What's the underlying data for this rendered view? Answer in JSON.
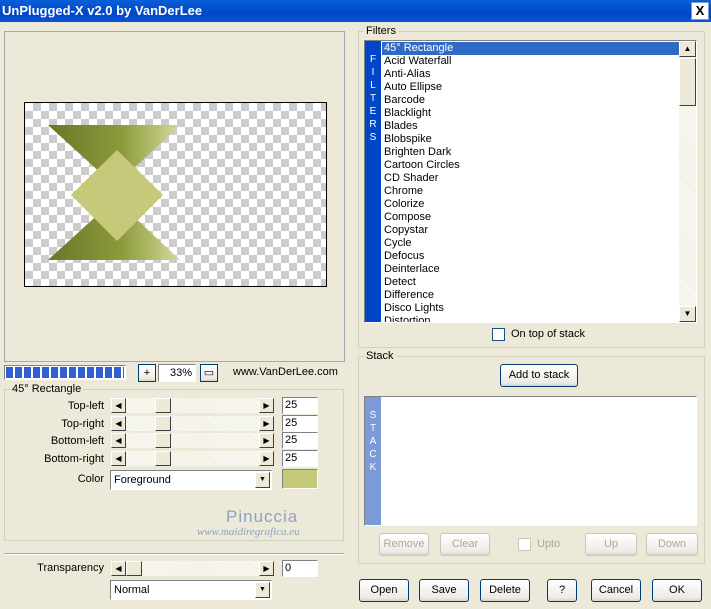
{
  "window": {
    "title": "UnPlugged-X v2.0 by VanDerLee",
    "close_label": "X"
  },
  "progress": {
    "fraction": 0.36
  },
  "zoom": {
    "minus_label": "+",
    "value": "33%",
    "fit_label": "▭"
  },
  "website": "www.VanDerLee.com",
  "params": {
    "group_title": "45° Rectangle",
    "sliders": [
      {
        "label": "Top-left",
        "value": "25",
        "fraction": 0.25
      },
      {
        "label": "Top-right",
        "value": "25",
        "fraction": 0.25
      },
      {
        "label": "Bottom-left",
        "value": "25",
        "fraction": 0.25
      },
      {
        "label": "Bottom-right",
        "value": "25",
        "fraction": 0.25
      }
    ],
    "color_label": "Color",
    "color_value": "Foreground",
    "swatch_color": "#c5c979"
  },
  "watermark": {
    "name": "Pinuccia",
    "url": "www.maidiregrafica.eu"
  },
  "transparency": {
    "label": "Transparency",
    "value": "0",
    "fraction": 0.0
  },
  "blend": {
    "value": "Normal"
  },
  "filters": {
    "title": "Filters",
    "vertical_label": [
      "F",
      "I",
      "L",
      "T",
      "E",
      "R",
      "S"
    ],
    "items": [
      "45° Rectangle",
      "Acid Waterfall",
      "Anti-Alias",
      "Auto Ellipse",
      "Barcode",
      "Blacklight",
      "Blades",
      "Blobspike",
      "Brighten Dark",
      "Cartoon Circles",
      "CD Shader",
      "Chrome",
      "Colorize",
      "Compose",
      "Copystar",
      "Cycle",
      "Defocus",
      "Deinterlace",
      "Detect",
      "Difference",
      "Disco Lights",
      "Distortion"
    ],
    "selected_index": 0,
    "on_top_label": "On top of stack"
  },
  "stack": {
    "title": "Stack",
    "add_label": "Add to stack",
    "vertical_label": [
      "S",
      "T",
      "A",
      "C",
      "K"
    ],
    "remove_label": "Remove",
    "clear_label": "Clear",
    "upto_label": "Upto",
    "up_label": "Up",
    "down_label": "Down"
  },
  "bottom_buttons": {
    "open": "Open",
    "save": "Save",
    "delete": "Delete",
    "help": "?",
    "cancel": "Cancel",
    "ok": "OK"
  },
  "colors": {
    "shape_dark": "#6b7629",
    "shape_light": "#c5c979",
    "selection": "#316ac5",
    "filters_bar": "#0046c8",
    "stack_bar": "#7b9ad8"
  }
}
